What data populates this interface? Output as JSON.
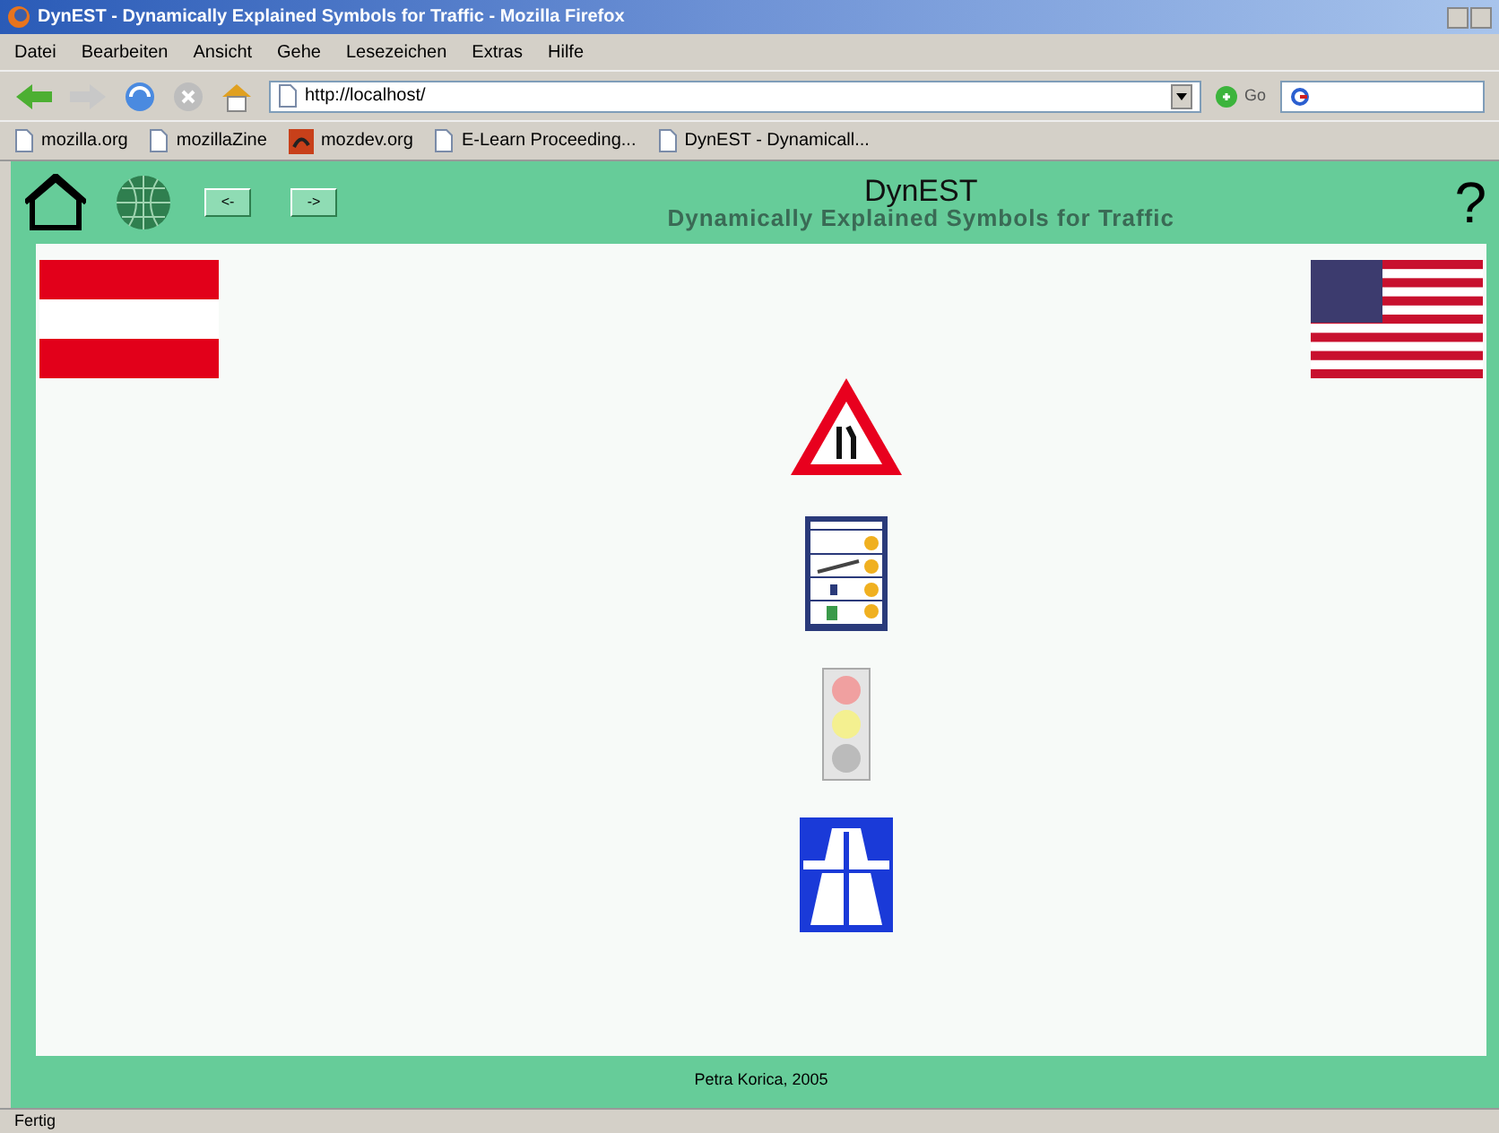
{
  "window": {
    "title": "DynEST - Dynamically Explained Symbols for Traffic - Mozilla Firefox"
  },
  "menu": [
    "Datei",
    "Bearbeiten",
    "Ansicht",
    "Gehe",
    "Lesezeichen",
    "Extras",
    "Hilfe"
  ],
  "address": {
    "value": "http://localhost/"
  },
  "go_label": "Go",
  "bookmarks": [
    {
      "label": "mozilla.org",
      "kind": "page"
    },
    {
      "label": "mozillaZine",
      "kind": "page"
    },
    {
      "label": "mozdev.org",
      "kind": "mozdev"
    },
    {
      "label": "E-Learn Proceeding...",
      "kind": "page"
    },
    {
      "label": "DynEST - Dynamicall...",
      "kind": "page"
    }
  ],
  "page": {
    "title": "DynEST",
    "subtitle": "Dynamically Explained Symbols for Traffic",
    "nav_buttons": [
      "<-",
      "->"
    ],
    "help": "?",
    "footer": "Petra Korica, 2005"
  },
  "status_bar": "Fertig"
}
